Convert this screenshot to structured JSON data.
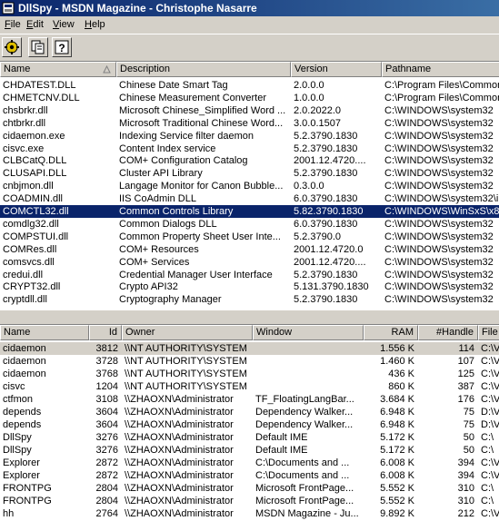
{
  "window": {
    "title": "DllSpy - MSDN Magazine - Christophe Nasarre",
    "title_bar_color": "#0a246a"
  },
  "menu": {
    "items": [
      {
        "label": "File"
      },
      {
        "label": "Edit"
      },
      {
        "label": "View"
      },
      {
        "label": "Help"
      }
    ]
  },
  "toolbar": {
    "buttons": [
      {
        "icon": "gear-icon"
      },
      {
        "icon": "copy-icon"
      },
      {
        "icon": "help-icon"
      }
    ]
  },
  "modules": {
    "columns": [
      "Name",
      "Description",
      "Version",
      "Pathname"
    ],
    "selected_color": "#0a246a",
    "rows": [
      {
        "name": "CHDATEST.DLL",
        "description": "Chinese Date Smart Tag",
        "version": "2.0.0.0",
        "pathname": "C:\\Program Files\\Common"
      },
      {
        "name": "CHMETCNV.DLL",
        "description": "Chinese Measurement Converter",
        "version": "1.0.0.0",
        "pathname": "C:\\Program Files\\Common"
      },
      {
        "name": "chsbrkr.dll",
        "description": "Microsoft Chinese_Simplified Word ...",
        "version": "2.0.2022.0",
        "pathname": "C:\\WINDOWS\\system32"
      },
      {
        "name": "chtbrkr.dll",
        "description": "Microsoft Traditional Chinese Word...",
        "version": "3.0.0.1507",
        "pathname": "C:\\WINDOWS\\system32"
      },
      {
        "name": "cidaemon.exe",
        "description": "Indexing Service filter daemon",
        "version": "5.2.3790.1830",
        "pathname": "C:\\WINDOWS\\system32"
      },
      {
        "name": "cisvc.exe",
        "description": "Content Index service",
        "version": "5.2.3790.1830",
        "pathname": "C:\\WINDOWS\\system32"
      },
      {
        "name": "CLBCatQ.DLL",
        "description": "COM+ Configuration Catalog",
        "version": "2001.12.4720....",
        "pathname": "C:\\WINDOWS\\system32"
      },
      {
        "name": "CLUSAPI.DLL",
        "description": "Cluster API Library",
        "version": "5.2.3790.1830",
        "pathname": "C:\\WINDOWS\\system32"
      },
      {
        "name": "cnbjmon.dll",
        "description": "Langage Monitor for Canon Bubble...",
        "version": "0.3.0.0",
        "pathname": "C:\\WINDOWS\\system32"
      },
      {
        "name": "COADMIN.dll",
        "description": "IIS CoAdmin DLL",
        "version": "6.0.3790.1830",
        "pathname": "C:\\WINDOWS\\system32\\in"
      },
      {
        "name": "COMCTL32.dll",
        "description": "Common Controls Library",
        "version": "5.82.3790.1830",
        "pathname": "C:\\WINDOWS\\WinSxS\\x86"
      },
      {
        "name": "comdlg32.dll",
        "description": "Common Dialogs DLL",
        "version": "6.0.3790.1830",
        "pathname": "C:\\WINDOWS\\system32"
      },
      {
        "name": "COMPSTUI.dll",
        "description": "Common Property Sheet User Inte...",
        "version": "5.2.3790.0",
        "pathname": "C:\\WINDOWS\\system32"
      },
      {
        "name": "COMRes.dll",
        "description": "COM+ Resources",
        "version": "2001.12.4720.0",
        "pathname": "C:\\WINDOWS\\system32"
      },
      {
        "name": "comsvcs.dll",
        "description": "COM+ Services",
        "version": "2001.12.4720....",
        "pathname": "C:\\WINDOWS\\system32"
      },
      {
        "name": "credui.dll",
        "description": "Credential Manager User Interface",
        "version": "5.2.3790.1830",
        "pathname": "C:\\WINDOWS\\system32"
      },
      {
        "name": "CRYPT32.dll",
        "description": "Crypto API32",
        "version": "5.131.3790.1830",
        "pathname": "C:\\WINDOWS\\system32"
      },
      {
        "name": "cryptdll.dll",
        "description": "Cryptography Manager",
        "version": "5.2.3790.1830",
        "pathname": "C:\\WINDOWS\\system32"
      }
    ]
  },
  "processes": {
    "columns": [
      "Name",
      "Id",
      "Owner",
      "Window",
      "RAM",
      "#Handle",
      "File"
    ],
    "rows": [
      {
        "name": "cidaemon",
        "id": "3812",
        "owner": "\\\\NT AUTHORITY\\SYSTEM",
        "window": "",
        "ram": "1.556 K",
        "handle": "114",
        "file": "C:\\V"
      },
      {
        "name": "cidaemon",
        "id": "3728",
        "owner": "\\\\NT AUTHORITY\\SYSTEM",
        "window": "",
        "ram": "1.460 K",
        "handle": "107",
        "file": "C:\\V"
      },
      {
        "name": "cidaemon",
        "id": "3768",
        "owner": "\\\\NT AUTHORITY\\SYSTEM",
        "window": "",
        "ram": "436 K",
        "handle": "125",
        "file": "C:\\V"
      },
      {
        "name": "cisvc",
        "id": "1204",
        "owner": "\\\\NT AUTHORITY\\SYSTEM",
        "window": "",
        "ram": "860 K",
        "handle": "387",
        "file": "C:\\V"
      },
      {
        "name": "ctfmon",
        "id": "3108",
        "owner": "\\\\ZHAOXN\\Administrator",
        "window": "TF_FloatingLangBar...",
        "ram": "3.684 K",
        "handle": "176",
        "file": "C:\\V"
      },
      {
        "name": "depends",
        "id": "3604",
        "owner": "\\\\ZHAOXN\\Administrator",
        "window": "Dependency Walker...",
        "ram": "6.948 K",
        "handle": "75",
        "file": "D:\\V"
      },
      {
        "name": "depends",
        "id": "3604",
        "owner": "\\\\ZHAOXN\\Administrator",
        "window": "Dependency Walker...",
        "ram": "6.948 K",
        "handle": "75",
        "file": "D:\\V"
      },
      {
        "name": "DllSpy",
        "id": "3276",
        "owner": "\\\\ZHAOXN\\Administrator",
        "window": "Default IME",
        "ram": "5.172 K",
        "handle": "50",
        "file": "C:\\"
      },
      {
        "name": "DllSpy",
        "id": "3276",
        "owner": "\\\\ZHAOXN\\Administrator",
        "window": "Default IME",
        "ram": "5.172 K",
        "handle": "50",
        "file": "C:\\"
      },
      {
        "name": "Explorer",
        "id": "2872",
        "owner": "\\\\ZHAOXN\\Administrator",
        "window": "C:\\Documents and ...",
        "ram": "6.008 K",
        "handle": "394",
        "file": "C:\\V"
      },
      {
        "name": "Explorer",
        "id": "2872",
        "owner": "\\\\ZHAOXN\\Administrator",
        "window": "C:\\Documents and ...",
        "ram": "6.008 K",
        "handle": "394",
        "file": "C:\\V"
      },
      {
        "name": "FRONTPG",
        "id": "2804",
        "owner": "\\\\ZHAOXN\\Administrator",
        "window": "Microsoft FrontPage...",
        "ram": "5.552 K",
        "handle": "310",
        "file": "C:\\"
      },
      {
        "name": "FRONTPG",
        "id": "2804",
        "owner": "\\\\ZHAOXN\\Administrator",
        "window": "Microsoft FrontPage...",
        "ram": "5.552 K",
        "handle": "310",
        "file": "C:\\"
      },
      {
        "name": "hh",
        "id": "2764",
        "owner": "\\\\ZHAOXN\\Administrator",
        "window": "MSDN Magazine - Ju...",
        "ram": "9.892 K",
        "handle": "212",
        "file": "C:\\V"
      }
    ]
  }
}
